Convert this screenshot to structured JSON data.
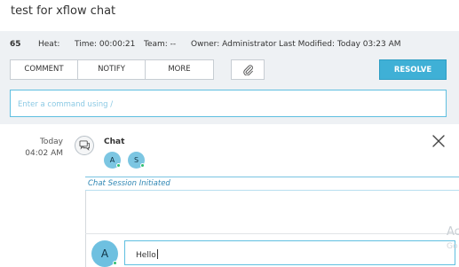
{
  "header": {
    "title": "test for xflow chat"
  },
  "meta": {
    "id": "65",
    "heat": "Heat:",
    "time": "Time: 00:00:21",
    "team": "Team: --",
    "owner": "Owner: Administrator",
    "modified": "Last Modified: Today 03:23 AM"
  },
  "toolbar": {
    "buttons": [
      "COMMENT",
      "NOTIFY",
      "MORE"
    ],
    "resolve_label": "RESOLVE",
    "attach_icon": "paperclip-icon"
  },
  "command": {
    "placeholder": "Enter a command using /"
  },
  "timeline": {
    "day": "Today",
    "time": "04:02 AM",
    "chat_label": "Chat",
    "participants": [
      "A",
      "S"
    ],
    "session_text": "Chat Session Initiated"
  },
  "composer": {
    "avatar": "A",
    "value": "Hello"
  },
  "watermark": {
    "line1": "Ac",
    "line2": "Go"
  },
  "colors": {
    "accent": "#3fb0d6",
    "online": "#2fbf71",
    "session_text": "#2f87b4"
  }
}
